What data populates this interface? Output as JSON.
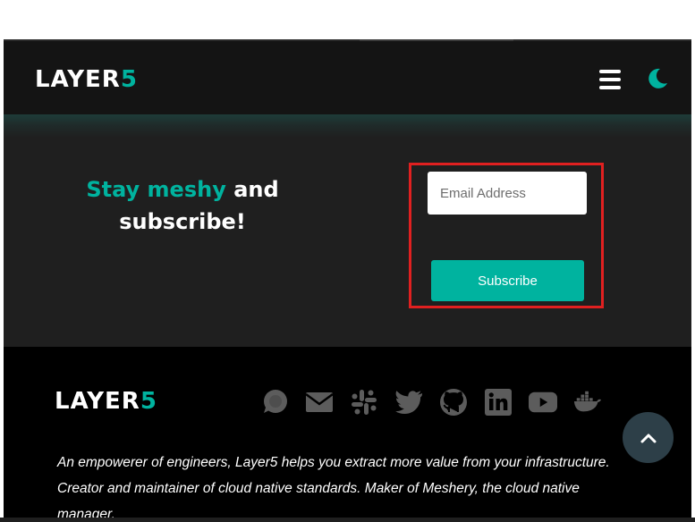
{
  "header": {
    "logo": {
      "text_main": "LAYER",
      "text_accent": "5"
    },
    "menu_icon": "hamburger-icon",
    "theme_icon": "moon-icon"
  },
  "subscribe": {
    "headline_accent": "Stay meshy",
    "headline_rest_1": " and",
    "headline_rest_2": "subscribe!",
    "email_placeholder": "Email Address",
    "email_value": "",
    "button_label": "Subscribe"
  },
  "footer": {
    "logo": {
      "text_main": "LAYER",
      "text_accent": "5"
    },
    "socials": [
      {
        "name": "discuss-icon"
      },
      {
        "name": "mail-icon"
      },
      {
        "name": "slack-icon"
      },
      {
        "name": "twitter-icon"
      },
      {
        "name": "github-icon"
      },
      {
        "name": "linkedin-icon"
      },
      {
        "name": "youtube-icon"
      },
      {
        "name": "docker-icon"
      }
    ],
    "description": "An empowerer of engineers, Layer5 helps you extract more value from your infrastructure. Creator and maintainer of cloud native standards. Maker of Meshery, the cloud native manager."
  },
  "scroll_top_icon": "chevron-up-icon",
  "colors": {
    "accent": "#00b39f",
    "header_bg": "#141414",
    "section_bg": "#1f1f1f",
    "footer_bg": "#000000",
    "highlight": "#e02020"
  }
}
